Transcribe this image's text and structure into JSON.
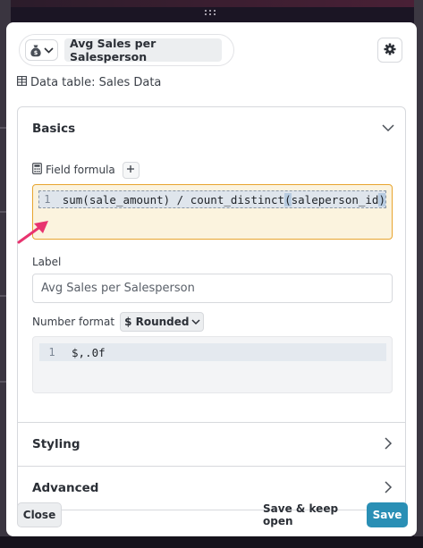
{
  "header": {
    "title_value": "Avg Sales per Salesperson",
    "data_table_text": "Data table: Sales Data"
  },
  "sections": {
    "basics_label": "Basics",
    "styling_label": "Styling",
    "advanced_label": "Advanced"
  },
  "basics": {
    "field_formula_label": "Field formula",
    "formula_line_number": "1",
    "formula_parts": [
      "sum(sale_amount) / count_distinct",
      "(",
      "saleperson_id",
      ")"
    ],
    "label_heading": "Label",
    "label_value": "Avg Sales per Salesperson",
    "number_format_label": "Number format",
    "number_format_selected": "$ Rounded",
    "format_line_number": "1",
    "format_code": "$,.0f"
  },
  "footer": {
    "close_label": "Close",
    "save_keep_label": "Save & keep open",
    "save_label": "Save"
  },
  "colors": {
    "accent": "#2a8fb5",
    "formula_focus_border": "#e8a52f",
    "annotation_arrow": "#e8346f"
  }
}
